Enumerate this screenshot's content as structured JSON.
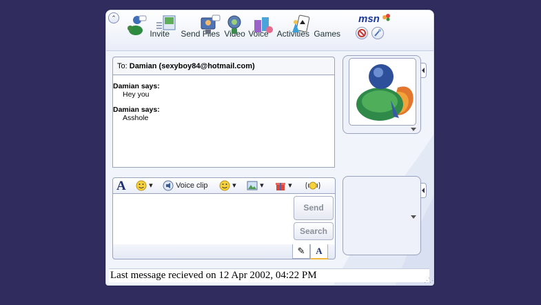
{
  "toolbar": {
    "menu_glyph": "⌃",
    "items": [
      {
        "label": "Invite",
        "icon": "invite-icon"
      },
      {
        "label": "Send Files",
        "icon": "send-files-icon"
      },
      {
        "label": "Video",
        "icon": "video-icon"
      },
      {
        "label": "Voice",
        "icon": "voice-icon"
      },
      {
        "label": "Activities",
        "icon": "activities-icon"
      },
      {
        "label": "Games",
        "icon": "games-icon"
      }
    ],
    "brand": "msn",
    "brand_buttons": [
      "block-icon",
      "personalize-icon"
    ]
  },
  "conversation": {
    "to_prefix": "To:",
    "to_contact": "Damian (sexyboy84@hotmail.com)",
    "messages": [
      {
        "sender": "Damian says:",
        "text": "Hey you"
      },
      {
        "sender": "Damian says:",
        "text": "Asshole"
      }
    ]
  },
  "format_bar": {
    "font_glyph": "A",
    "voice_clip_label": "Voice clip",
    "dropdown_glyph": "▾",
    "items": [
      "font-icon",
      "emoticon-icon",
      "voice-clip-icon",
      "wink-icon",
      "background-icon",
      "gift-icon",
      "nudge-icon"
    ]
  },
  "input": {
    "value": "",
    "send_label": "Send",
    "search_label": "Search"
  },
  "tabs": {
    "handwrite_glyph": "✎",
    "type_glyph": "A"
  },
  "status": {
    "text": "Last message recieved on 12 Apr 2002, 04:22 PM"
  },
  "colors": {
    "background": "#302d5e",
    "window": "#f2f4fb",
    "border": "#98a2be",
    "brand": "#1d3a9a"
  }
}
